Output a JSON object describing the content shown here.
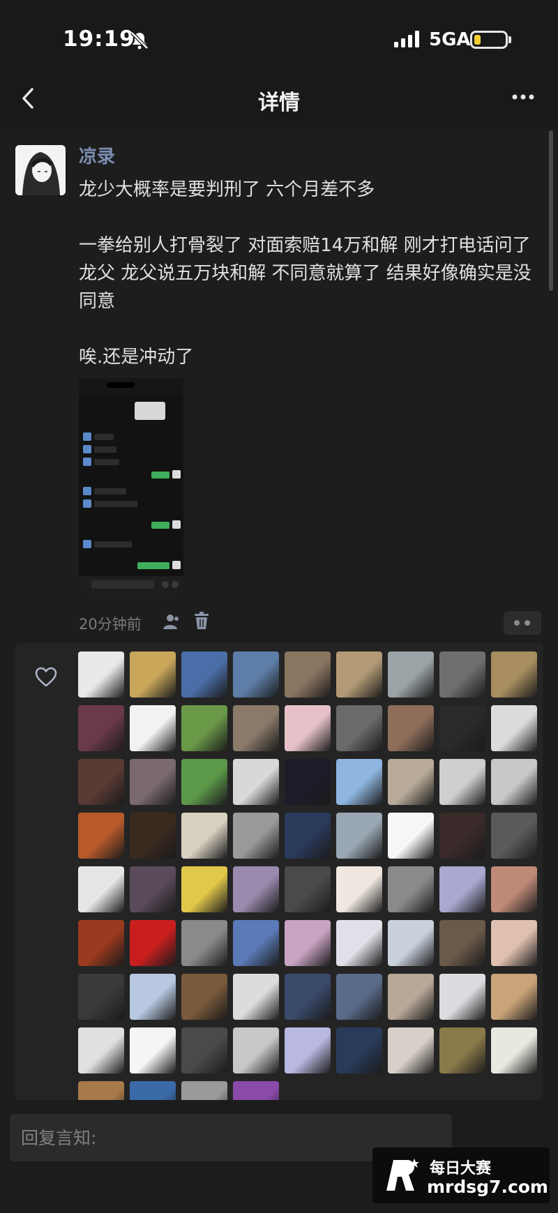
{
  "status_bar": {
    "time": "19:19",
    "network": "5GA"
  },
  "nav": {
    "title": "详情"
  },
  "post": {
    "author": "凉录",
    "lines": [
      "龙少大概率是要判刑了 六个月差不多",
      "",
      "一拳给别人打骨裂了 对面索赔14万和解 刚才打电话问了龙父 龙父说五万块和解 不同意就算了 结果好像确实是没同意",
      "",
      "唉.还是冲动了"
    ],
    "time": "20分钟前"
  },
  "like_avatar_colors": [
    "#e8e8e8",
    "#c9a65a",
    "#4a6fa8",
    "#5d7ea8",
    "#8a7560",
    "#b39a76",
    "#9aa3a6",
    "#6f6f6f",
    "#a88e5f",
    "#6b3a4a",
    "#f2f2f2",
    "#6a9a48",
    "#8a7a6a",
    "#e6c2c8",
    "#6a6a6a",
    "#8e6e5a",
    "#2a2a2a",
    "#dcdcdc",
    "#5a3a34",
    "#7a6a70",
    "#5c9a4a",
    "#d8d8d8",
    "#1c1c2a",
    "#8fb6e0",
    "#b8ab9a",
    "#cfcfcf",
    "#c8c8c8",
    "#b85a2a",
    "#3a2a1e",
    "#d8d0c0",
    "#9a9a9a",
    "#2a3a5a",
    "#9aa8b4",
    "#f7f7f7",
    "#3a2a2a",
    "#5a5a5a",
    "#e6e6e6",
    "#5a4a5a",
    "#e2c84a",
    "#9a8aae",
    "#4a4a4a",
    "#f0e8e0",
    "#8a8a8a",
    "#a8a8d0",
    "#c08a78",
    "#9a3a1e",
    "#c81e1e",
    "#8a8a8a",
    "#5a7ab8",
    "#c9a4c4",
    "#e0e0e8",
    "#c8d0dc",
    "#6a5a4a",
    "#e0c0b0",
    "#3a3a3a",
    "#b8c8e0",
    "#7a5a3a",
    "#dcdcdc",
    "#3a4a6a",
    "#5a6a8a",
    "#b8a898",
    "#dcdce0",
    "#c8a478",
    "#e0e0e0",
    "#f5f5f5",
    "#4a4a4a",
    "#c8c8c8",
    "#b8b8e0",
    "#2a3a5a",
    "#d8d0c8",
    "#8a7a4a",
    "#e8e8e0",
    "#a87a4a",
    "#3a6aa8",
    "#9a9a9a",
    "#8a4aa8"
  ],
  "reply": {
    "placeholder": "回复言知:"
  },
  "watermark": {
    "line1": "每日大赛",
    "line2": "mrdsg7.com"
  }
}
